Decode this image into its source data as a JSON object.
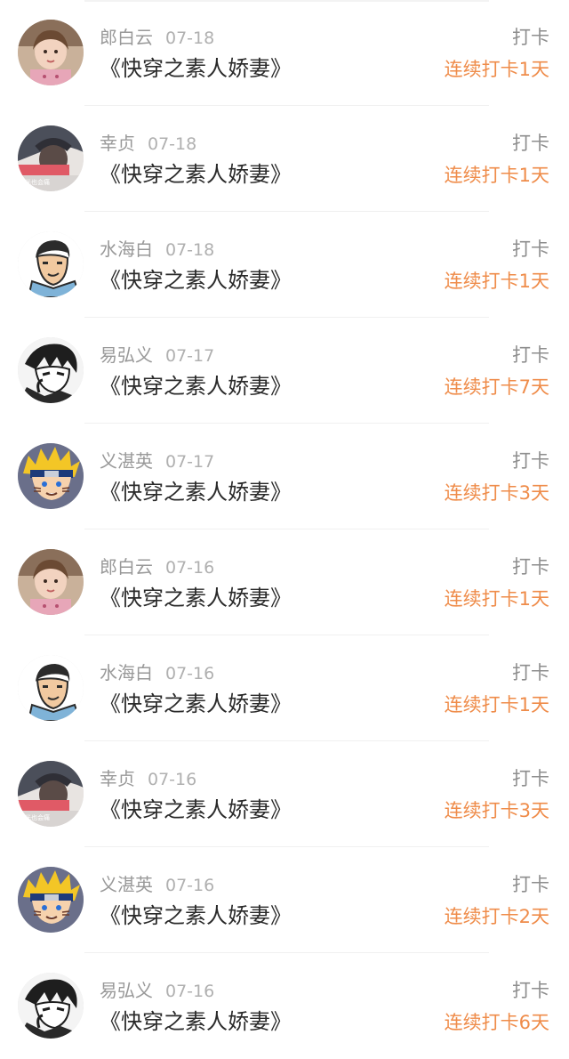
{
  "records": [
    {
      "user": "郎白云",
      "date": "07-18",
      "book": "《快穿之素人娇妻》",
      "type": "打卡",
      "streak": "连续打卡1天",
      "avatar": "girl-photo-avatar"
    },
    {
      "user": "幸贞",
      "date": "07-18",
      "book": "《快穿之素人娇妻》",
      "type": "打卡",
      "streak": "连续打卡1天",
      "avatar": "boy-photo-avatar"
    },
    {
      "user": "水海白",
      "date": "07-18",
      "book": "《快穿之素人娇妻》",
      "type": "打卡",
      "streak": "连续打卡1天",
      "avatar": "cartoon-man-avatar"
    },
    {
      "user": "易弘义",
      "date": "07-17",
      "book": "《快穿之素人娇妻》",
      "type": "打卡",
      "streak": "连续打卡7天",
      "avatar": "anime-bw-avatar"
    },
    {
      "user": "义湛英",
      "date": "07-17",
      "book": "《快穿之素人娇妻》",
      "type": "打卡",
      "streak": "连续打卡3天",
      "avatar": "naruto-avatar"
    },
    {
      "user": "郎白云",
      "date": "07-16",
      "book": "《快穿之素人娇妻》",
      "type": "打卡",
      "streak": "连续打卡1天",
      "avatar": "girl-photo-avatar"
    },
    {
      "user": "水海白",
      "date": "07-16",
      "book": "《快穿之素人娇妻》",
      "type": "打卡",
      "streak": "连续打卡1天",
      "avatar": "cartoon-man-avatar"
    },
    {
      "user": "幸贞",
      "date": "07-16",
      "book": "《快穿之素人娇妻》",
      "type": "打卡",
      "streak": "连续打卡3天",
      "avatar": "boy-photo-avatar"
    },
    {
      "user": "义湛英",
      "date": "07-16",
      "book": "《快穿之素人娇妻》",
      "type": "打卡",
      "streak": "连续打卡2天",
      "avatar": "naruto-avatar"
    },
    {
      "user": "易弘义",
      "date": "07-16",
      "book": "《快穿之素人娇妻》",
      "type": "打卡",
      "streak": "连续打卡6天",
      "avatar": "anime-bw-avatar"
    }
  ],
  "colors": {
    "accent_orange": "#ef8c4a",
    "muted_text": "#999999",
    "title_text": "#2a2a2a",
    "divider": "#f0f0f0"
  }
}
